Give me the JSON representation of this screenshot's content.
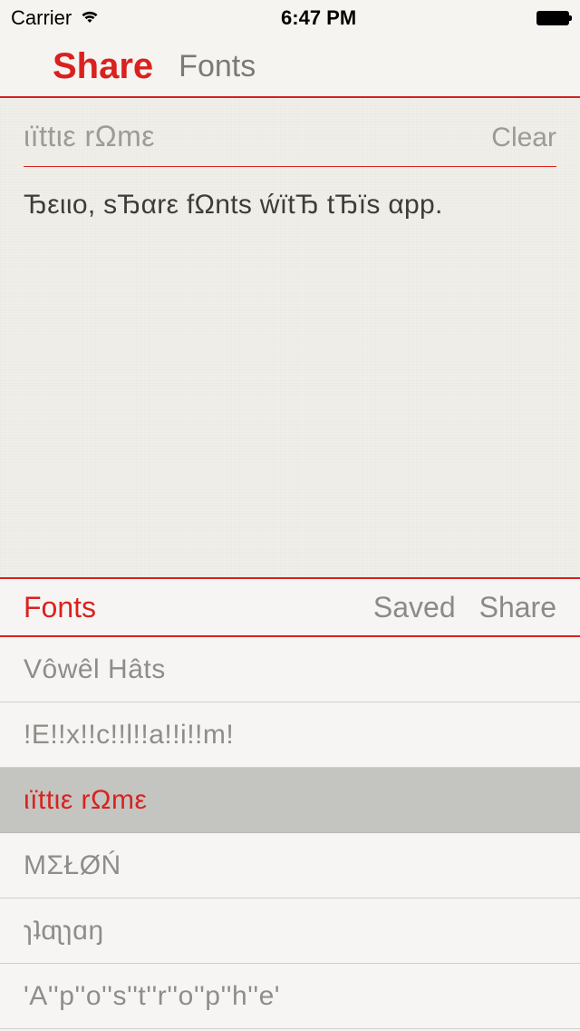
{
  "status": {
    "carrier": "Carrier",
    "time": "6:47 PM"
  },
  "nav": {
    "share": "Share",
    "fonts": "Fonts"
  },
  "editor": {
    "current_font_name": "ιïttιε rΩmε",
    "clear_label": "Clear",
    "body": "Ђειιо, sЂαrε fΩnts ẃïtЂ tЂïs αpp."
  },
  "tabs": {
    "fonts": "Fonts",
    "saved": "Saved",
    "share": "Share"
  },
  "fonts": [
    {
      "label": "Vôwêl Hâts",
      "selected": false
    },
    {
      "label": "!E!!x!!c!!l!!a!!i!!m!",
      "selected": false
    },
    {
      "label": "ιïttιε rΩmε",
      "selected": true
    },
    {
      "label": "ΜΣŁØŃ",
      "selected": false
    },
    {
      "label": "ɿʇɑʅɿɑŋ",
      "selected": false
    },
    {
      "label": "'A''p''o''s''t''r''o''p''h''e'",
      "selected": false
    }
  ],
  "colors": {
    "accent": "#d9221f"
  }
}
